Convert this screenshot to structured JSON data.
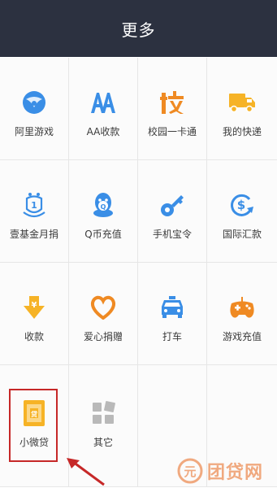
{
  "header": {
    "title": "更多"
  },
  "items": [
    {
      "label": "阿里游戏",
      "icon": "ali-games-icon"
    },
    {
      "label": "AA收款",
      "icon": "aa-collection-icon"
    },
    {
      "label": "校园一卡通",
      "icon": "campus-card-icon"
    },
    {
      "label": "我的快递",
      "icon": "express-delivery-icon"
    },
    {
      "label": "壹基金月捐",
      "icon": "one-foundation-icon"
    },
    {
      "label": "Q币充值",
      "icon": "qq-coin-icon"
    },
    {
      "label": "手机宝令",
      "icon": "phone-token-icon"
    },
    {
      "label": "国际汇款",
      "icon": "international-remittance-icon"
    },
    {
      "label": "收款",
      "icon": "collect-money-icon"
    },
    {
      "label": "爱心捐赠",
      "icon": "charity-donation-icon"
    },
    {
      "label": "打车",
      "icon": "taxi-icon"
    },
    {
      "label": "游戏充值",
      "icon": "game-recharge-icon"
    },
    {
      "label": "小微贷",
      "icon": "micro-loan-icon"
    },
    {
      "label": "其它",
      "icon": "other-apps-icon"
    }
  ],
  "watermark": {
    "text": "团贷网",
    "logo_char": "元"
  },
  "colors": {
    "header_bg": "#2c3140",
    "accent_blue": "#3a8ee6",
    "accent_orange": "#ef8a23",
    "accent_yellow": "#f6b326",
    "highlight_red": "#c62828"
  }
}
